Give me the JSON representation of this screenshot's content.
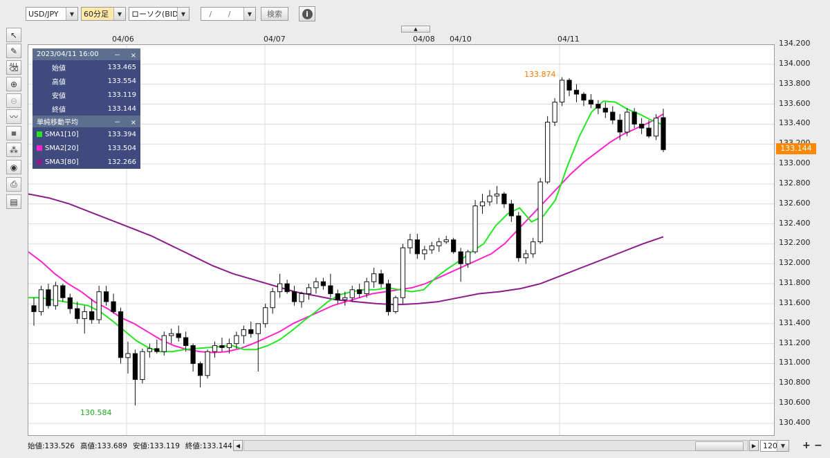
{
  "toolbar": {
    "pair": "USD/JPY",
    "timeframe": "60分足",
    "chart_type": "ローソク(BID)",
    "date_placeholder": "/ /",
    "search_label": "検索",
    "info_icon": "info-icon"
  },
  "left_tools": [
    "cursor-icon",
    "pen-icon",
    "erase-all-icon",
    "zoom-in-icon",
    "zoom-out-icon",
    "indicator-icon",
    "price-table-icon",
    "pattern-icon",
    "view-icon",
    "print-icon",
    "table-icon"
  ],
  "left_tools_all_label": "ALL",
  "info_panel": {
    "datetime": "2023/04/11 16:00",
    "rows": [
      {
        "label": "始値",
        "value": "133.465"
      },
      {
        "label": "高値",
        "value": "133.554"
      },
      {
        "label": "安値",
        "value": "133.119"
      },
      {
        "label": "終値",
        "value": "133.144"
      }
    ],
    "sma_title": "単純移動平均",
    "sma": [
      {
        "label": "SMA1[10]",
        "value": "133.394",
        "color": "#22e622"
      },
      {
        "label": "SMA2[20]",
        "value": "133.504",
        "color": "#ff22cc"
      },
      {
        "label": "SMA3[80]",
        "value": "132.266",
        "color": "#8b1a8b"
      }
    ],
    "min_btn": "－",
    "close_btn": "×"
  },
  "status_bar": {
    "open": "始値:133.526",
    "high": "高値:133.689",
    "low": "安値:133.119",
    "close": "終値:133.144",
    "zoom": "120"
  },
  "chart_data": {
    "type": "candlestick",
    "x_labels": [
      "04/06",
      "04/07",
      "04/08",
      "04/10",
      "04/11"
    ],
    "ylim": [
      130.4,
      134.2
    ],
    "y_ticks": [
      "130.400",
      "130.600",
      "130.800",
      "131.000",
      "131.200",
      "131.400",
      "131.600",
      "131.800",
      "132.000",
      "132.200",
      "132.400",
      "132.600",
      "132.800",
      "133.000",
      "133.200",
      "133.400",
      "133.600",
      "133.800",
      "134.000",
      "134.200"
    ],
    "current_price": "133.144",
    "max_label": "133.874",
    "min_label": "130.584",
    "grid": true,
    "colors": {
      "up": "#ffffff",
      "down": "#000000",
      "sma1": "#22e622",
      "sma2": "#ff22cc",
      "sma3": "#8b1a8b",
      "max_label": "#ff7700",
      "min_label": "#22aa22",
      "price_tag": "#ff8800"
    },
    "candles": [
      [
        131.58,
        131.66,
        131.38,
        131.52
      ],
      [
        131.52,
        131.78,
        131.48,
        131.74
      ],
      [
        131.74,
        131.8,
        131.55,
        131.58
      ],
      [
        131.58,
        131.82,
        131.54,
        131.78
      ],
      [
        131.78,
        131.8,
        131.62,
        131.66
      ],
      [
        131.66,
        131.7,
        131.5,
        131.55
      ],
      [
        131.55,
        131.62,
        131.4,
        131.45
      ],
      [
        131.45,
        131.58,
        131.3,
        131.52
      ],
      [
        131.52,
        131.65,
        131.4,
        131.44
      ],
      [
        131.44,
        131.78,
        131.4,
        131.72
      ],
      [
        131.72,
        131.78,
        131.58,
        131.62
      ],
      [
        131.62,
        131.7,
        131.5,
        131.52
      ],
      [
        131.52,
        131.56,
        131.0,
        131.06
      ],
      [
        131.06,
        131.22,
        130.9,
        131.1
      ],
      [
        131.1,
        131.14,
        130.58,
        130.84
      ],
      [
        130.84,
        131.15,
        130.8,
        131.12
      ],
      [
        131.12,
        131.2,
        131.06,
        131.15
      ],
      [
        131.15,
        131.24,
        131.1,
        131.12
      ],
      [
        131.12,
        131.32,
        131.08,
        131.28
      ],
      [
        131.28,
        131.35,
        131.2,
        131.3
      ],
      [
        131.3,
        131.38,
        131.22,
        131.26
      ],
      [
        131.26,
        131.32,
        131.12,
        131.18
      ],
      [
        131.18,
        131.2,
        130.92,
        131.0
      ],
      [
        131.0,
        131.02,
        130.76,
        130.88
      ],
      [
        130.88,
        131.14,
        130.85,
        131.12
      ],
      [
        131.12,
        131.22,
        131.06,
        131.18
      ],
      [
        131.18,
        131.26,
        131.12,
        131.16
      ],
      [
        131.16,
        131.25,
        131.1,
        131.2
      ],
      [
        131.2,
        131.32,
        131.15,
        131.28
      ],
      [
        131.28,
        131.38,
        131.2,
        131.34
      ],
      [
        131.34,
        131.42,
        131.26,
        131.3
      ],
      [
        131.3,
        131.38,
        130.92,
        131.4
      ],
      [
        131.4,
        131.6,
        131.36,
        131.56
      ],
      [
        131.56,
        131.76,
        131.5,
        131.72
      ],
      [
        131.72,
        131.9,
        131.66,
        131.8
      ],
      [
        131.8,
        131.84,
        131.7,
        131.72
      ],
      [
        131.72,
        131.78,
        131.58,
        131.62
      ],
      [
        131.62,
        131.72,
        131.56,
        131.7
      ],
      [
        131.7,
        131.8,
        131.64,
        131.76
      ],
      [
        131.76,
        131.86,
        131.7,
        131.82
      ],
      [
        131.82,
        131.86,
        131.74,
        131.78
      ],
      [
        131.78,
        131.9,
        131.66,
        131.7
      ],
      [
        131.7,
        131.74,
        131.6,
        131.64
      ],
      [
        131.64,
        131.72,
        131.58,
        131.66
      ],
      [
        131.66,
        131.78,
        131.62,
        131.74
      ],
      [
        131.74,
        131.8,
        131.66,
        131.7
      ],
      [
        131.7,
        131.86,
        131.66,
        131.82
      ],
      [
        131.82,
        131.96,
        131.76,
        131.9
      ],
      [
        131.9,
        131.94,
        131.76,
        131.8
      ],
      [
        131.8,
        131.84,
        131.48,
        131.52
      ],
      [
        131.52,
        131.68,
        131.5,
        131.66
      ],
      [
        131.66,
        132.2,
        131.6,
        132.16
      ],
      [
        132.16,
        132.3,
        132.1,
        132.24
      ],
      [
        132.24,
        132.3,
        132.05,
        132.1
      ],
      [
        132.1,
        132.18,
        132.04,
        132.14
      ],
      [
        132.14,
        132.22,
        132.1,
        132.18
      ],
      [
        132.18,
        132.26,
        132.12,
        132.22
      ],
      [
        132.22,
        132.28,
        132.2,
        132.24
      ],
      [
        132.24,
        132.26,
        132.1,
        132.12
      ],
      [
        132.12,
        132.16,
        131.82,
        132.0
      ],
      [
        132.0,
        132.14,
        131.96,
        132.12
      ],
      [
        132.12,
        132.64,
        132.1,
        132.58
      ],
      [
        132.58,
        132.7,
        132.5,
        132.62
      ],
      [
        132.62,
        132.74,
        132.58,
        132.68
      ],
      [
        132.68,
        132.78,
        132.6,
        132.7
      ],
      [
        132.7,
        132.72,
        132.56,
        132.6
      ],
      [
        132.6,
        132.64,
        132.42,
        132.48
      ],
      [
        132.48,
        132.52,
        132.02,
        132.06
      ],
      [
        132.06,
        132.14,
        132.0,
        132.1
      ],
      [
        132.1,
        132.26,
        132.06,
        132.22
      ],
      [
        132.22,
        132.86,
        132.2,
        132.82
      ],
      [
        132.82,
        133.48,
        132.8,
        133.42
      ],
      [
        133.42,
        133.66,
        133.38,
        133.62
      ],
      [
        133.62,
        133.87,
        133.58,
        133.84
      ],
      [
        133.84,
        133.86,
        133.68,
        133.74
      ],
      [
        133.74,
        133.8,
        133.62,
        133.7
      ],
      [
        133.7,
        133.72,
        133.58,
        133.64
      ],
      [
        133.64,
        133.7,
        133.56,
        133.6
      ],
      [
        133.6,
        133.64,
        133.5,
        133.56
      ],
      [
        133.56,
        133.62,
        133.46,
        133.52
      ],
      [
        133.52,
        133.58,
        133.4,
        133.44
      ],
      [
        133.44,
        133.5,
        133.24,
        133.32
      ],
      [
        133.32,
        133.56,
        133.28,
        133.52
      ],
      [
        133.52,
        133.56,
        133.36,
        133.4
      ],
      [
        133.4,
        133.46,
        133.3,
        133.36
      ],
      [
        133.36,
        133.44,
        133.26,
        133.28
      ],
      [
        133.28,
        133.5,
        133.24,
        133.46
      ],
      [
        133.465,
        133.554,
        133.119,
        133.144
      ]
    ],
    "sma1": [
      131.66,
      131.66,
      131.64,
      131.62,
      131.6,
      131.58,
      131.52,
      131.43,
      131.33,
      131.23,
      131.16,
      131.12,
      131.12,
      131.14,
      131.15,
      131.16,
      131.17,
      131.18,
      131.14,
      131.14,
      131.18,
      131.24,
      131.33,
      131.43,
      131.52,
      131.62,
      131.69,
      131.72,
      131.74,
      131.74,
      131.76,
      131.74,
      131.72,
      131.74,
      131.86,
      131.95,
      132.03,
      132.12,
      132.2,
      132.38,
      132.5,
      132.56,
      132.42,
      132.48,
      132.64,
      132.98,
      133.28,
      133.52,
      133.63,
      133.62,
      133.55,
      133.5,
      133.44,
      133.39
    ],
    "sma2": [
      132.12,
      132.02,
      131.9,
      131.8,
      131.72,
      131.62,
      131.55,
      131.46,
      131.4,
      131.32,
      131.24,
      131.18,
      131.14,
      131.12,
      131.11,
      131.12,
      131.15,
      131.2,
      131.26,
      131.32,
      131.4,
      131.46,
      131.52,
      131.58,
      131.62,
      131.66,
      131.7,
      131.72,
      131.74,
      131.76,
      131.8,
      131.86,
      131.92,
      131.98,
      132.04,
      132.1,
      132.2,
      132.34,
      132.48,
      132.62,
      132.76,
      132.9,
      133.02,
      133.12,
      133.22,
      133.3,
      133.36,
      133.42,
      133.5
    ],
    "sma3": [
      132.7,
      132.66,
      132.6,
      132.52,
      132.44,
      132.36,
      132.28,
      132.18,
      132.08,
      131.98,
      131.9,
      131.84,
      131.78,
      131.72,
      131.68,
      131.64,
      131.62,
      131.6,
      131.59,
      131.6,
      131.62,
      131.66,
      131.7,
      131.72,
      131.75,
      131.8,
      131.88,
      131.96,
      132.04,
      132.12,
      132.2,
      132.27
    ]
  }
}
